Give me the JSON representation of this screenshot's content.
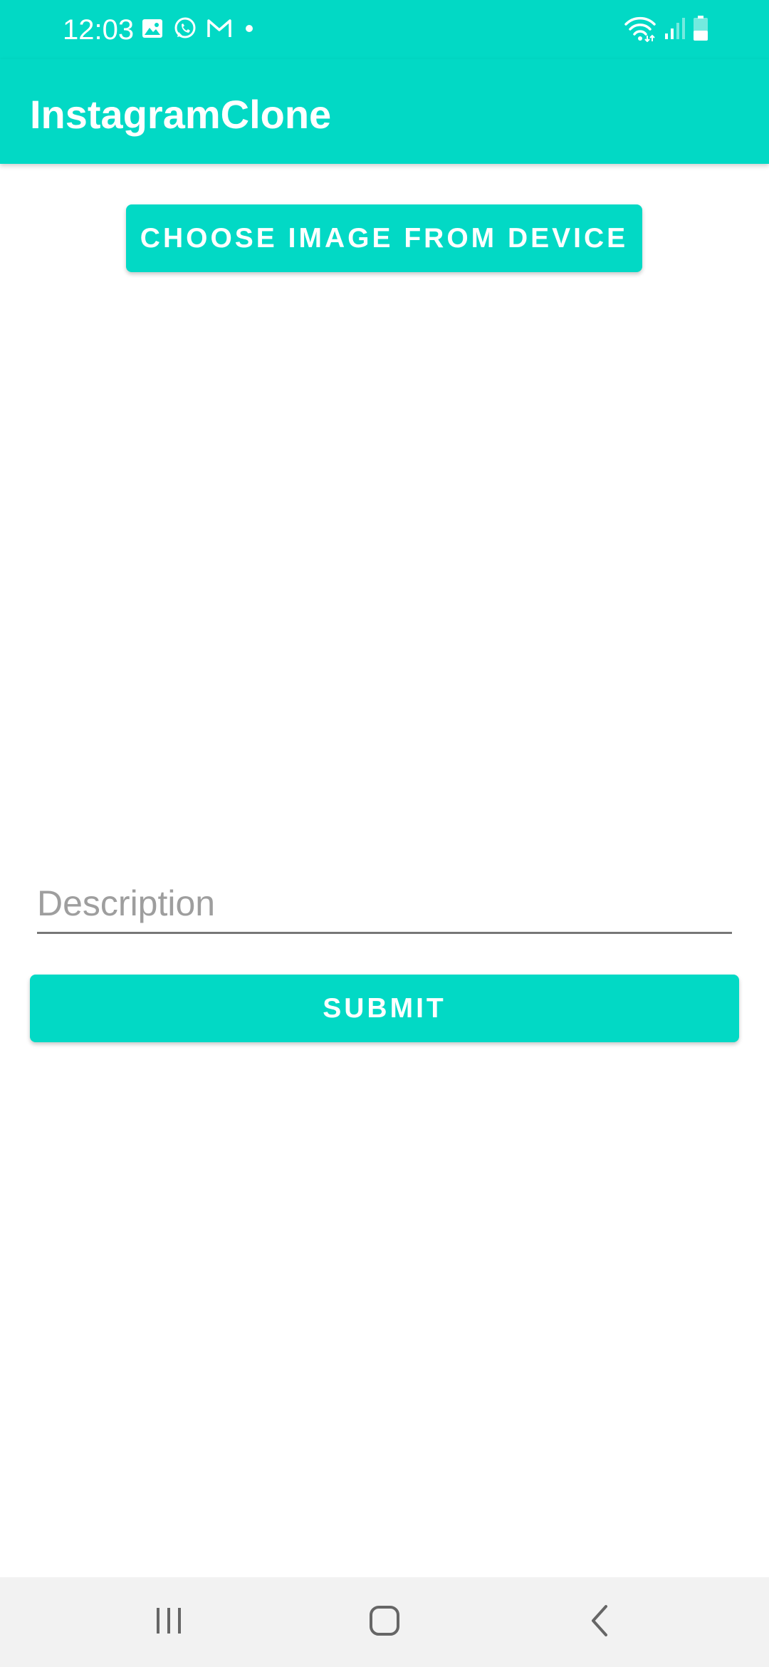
{
  "status_bar": {
    "time": "12:03",
    "left_icons": [
      "gallery-icon",
      "whatsapp-icon",
      "gmail-icon",
      "notification-dot-icon"
    ],
    "right_icons": [
      "wifi-icon",
      "signal-icon",
      "battery-icon"
    ]
  },
  "app_bar": {
    "title": "InstagramClone"
  },
  "main": {
    "choose_image_label": "CHOOSE IMAGE FROM DEVICE",
    "description_placeholder": "Description",
    "description_value": "",
    "submit_label": "SUBMIT"
  },
  "nav_bar": {
    "buttons": [
      "recents-icon",
      "home-icon",
      "back-icon"
    ]
  },
  "colors": {
    "accent": "#02d9c5",
    "background": "#ffffff",
    "nav_background": "#f2f2f2",
    "placeholder": "#9e9e9e"
  }
}
